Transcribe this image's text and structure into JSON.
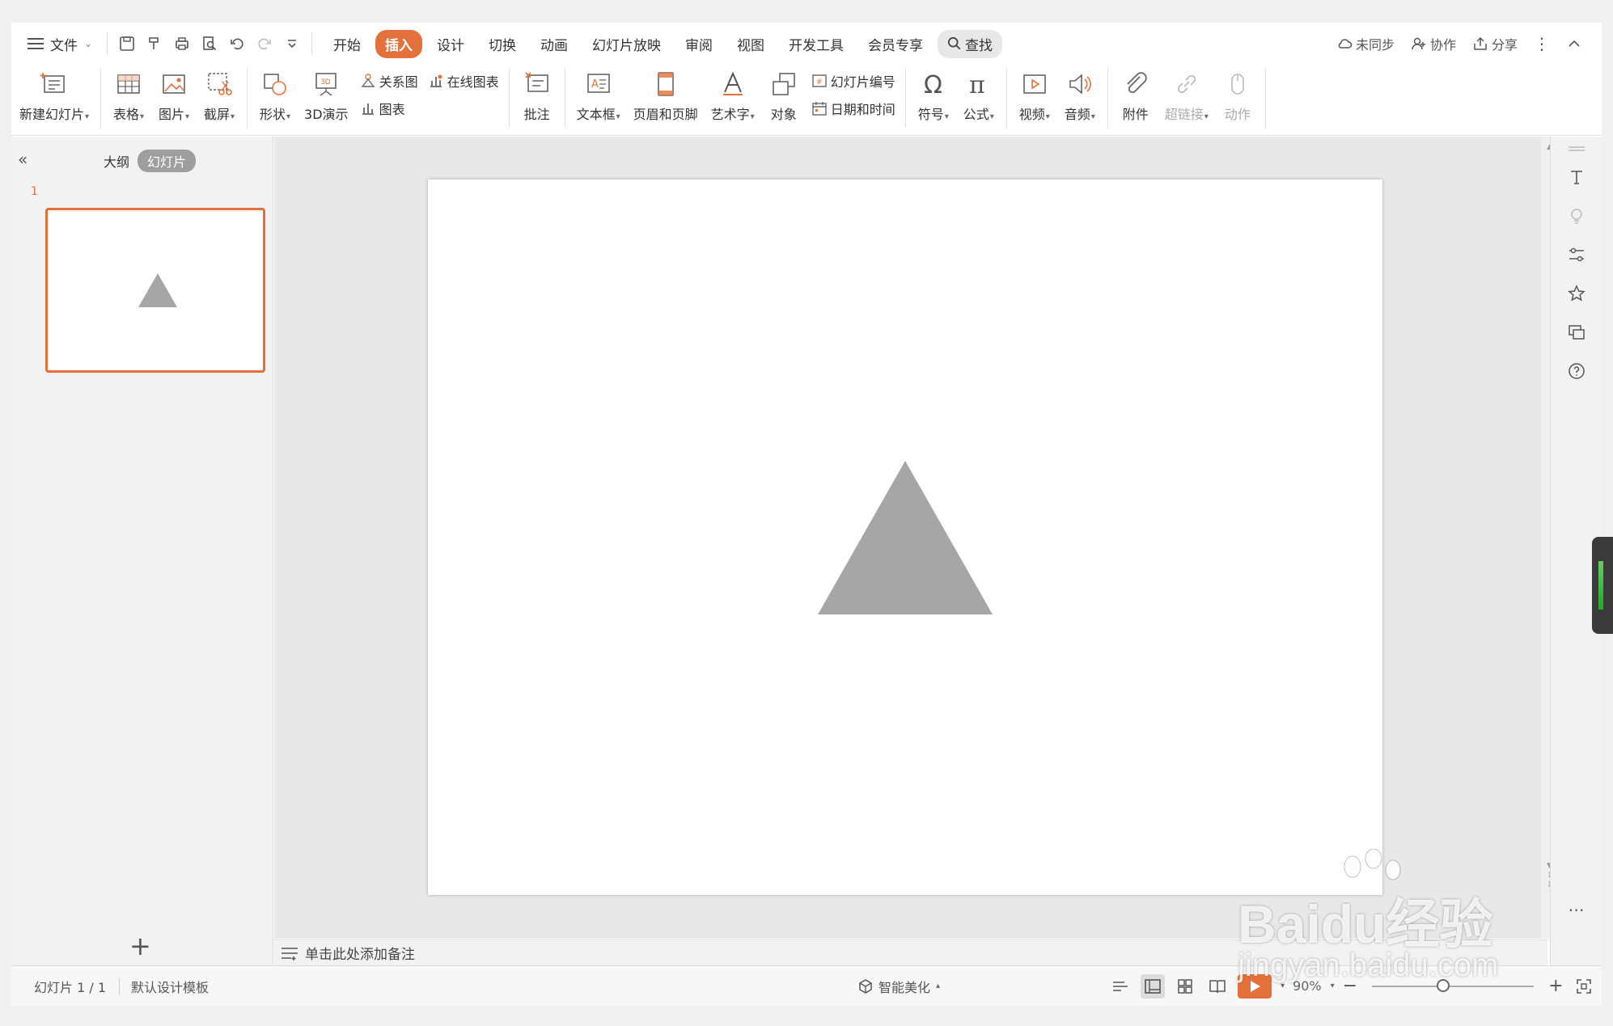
{
  "menu": {
    "file": "文件",
    "tabs": [
      "开始",
      "插入",
      "设计",
      "切换",
      "动画",
      "幻灯片放映",
      "审阅",
      "视图",
      "开发工具",
      "会员专享"
    ],
    "active_tab": "插入",
    "search": "查找",
    "right": {
      "sync": "未同步",
      "collab": "协作",
      "share": "分享"
    }
  },
  "ribbon": {
    "new_slide": "新建幻灯片",
    "table": "表格",
    "picture": "图片",
    "screenshot": "截屏",
    "shape": "形状",
    "demo3d": "3D演示",
    "relation": "关系图",
    "online_chart": "在线图表",
    "chart": "图表",
    "comment": "批注",
    "textbox": "文本框",
    "header_footer": "页眉和页脚",
    "wordart": "艺术字",
    "object": "对象",
    "slide_number": "幻灯片编号",
    "datetime": "日期和时间",
    "symbol": "符号",
    "formula": "公式",
    "video": "视频",
    "audio": "音频",
    "attachment": "附件",
    "hyperlink": "超链接",
    "action": "动作"
  },
  "panel": {
    "tab_outline": "大纲",
    "tab_slides": "幻灯片",
    "slide_number": "1",
    "add": "+"
  },
  "slide": {
    "shape": "triangle",
    "shape_color": "#a6a6a6"
  },
  "notes": {
    "placeholder": "单击此处添加备注"
  },
  "status": {
    "slide_info": "幻灯片 1 / 1",
    "template": "默认设计模板",
    "beautify": "智能美化",
    "zoom": "90%"
  },
  "colors": {
    "accent": "#e4713b",
    "selected_thumb_border": "#e4713b"
  },
  "watermark": {
    "brand": "Baidu经验",
    "url": "jingyan.baidu.com"
  }
}
